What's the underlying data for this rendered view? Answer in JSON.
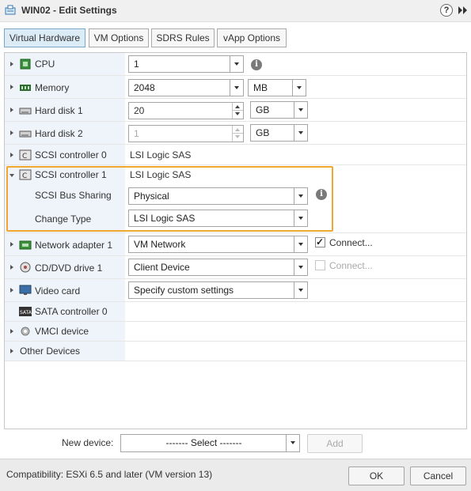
{
  "window": {
    "title": "WIN02 - Edit Settings",
    "help": "?"
  },
  "tabs": [
    {
      "label": "Virtual Hardware"
    },
    {
      "label": "VM Options"
    },
    {
      "label": "SDRS Rules"
    },
    {
      "label": "vApp Options"
    }
  ],
  "hardware": {
    "cpu": {
      "label": "CPU",
      "value": "1"
    },
    "memory": {
      "label": "Memory",
      "value": "2048",
      "unit": "MB"
    },
    "hard_disk_1": {
      "label": "Hard disk 1",
      "value": "20",
      "unit": "GB"
    },
    "hard_disk_2": {
      "label": "Hard disk 2",
      "value": "1",
      "unit": "GB"
    },
    "scsi_controller_0": {
      "label": "SCSI controller 0",
      "value": "LSI Logic SAS"
    },
    "scsi_controller_1": {
      "label": "SCSI controller 1",
      "value": "LSI Logic SAS",
      "bus_sharing": {
        "label": "SCSI Bus Sharing",
        "value": "Physical"
      },
      "change_type": {
        "label": "Change Type",
        "value": "LSI Logic SAS"
      }
    },
    "network_adapter_1": {
      "label": "Network adapter 1",
      "value": "VM Network",
      "connect_label": "Connect...",
      "connected": true
    },
    "cd_dvd_drive_1": {
      "label": "CD/DVD drive 1",
      "value": "Client Device",
      "connect_label": "Connect...",
      "connected": false
    },
    "video_card": {
      "label": "Video card",
      "value": "Specify custom settings"
    },
    "sata_controller_0": {
      "label": "SATA controller 0"
    },
    "vmci_device": {
      "label": "VMCI device"
    },
    "other_devices": {
      "label": "Other Devices"
    }
  },
  "new_device": {
    "label": "New device:",
    "select_value": "------- Select -------",
    "add_label": "Add"
  },
  "footer": {
    "compatibility": "Compatibility: ESXi 6.5 and later (VM version 13)",
    "ok_label": "OK",
    "cancel_label": "Cancel"
  },
  "colors": {
    "highlight": "#f0a830",
    "active_tab": "#dcecf7",
    "label_column": "#eef4fa",
    "footer": "#ebebeb"
  },
  "icons": [
    "vm-icon",
    "forward-icon",
    "cpu-icon",
    "memory-icon",
    "hard-disk-icon",
    "scsi-controller-icon",
    "network-adapter-icon",
    "cd-dvd-icon",
    "video-card-icon",
    "sata-controller-icon",
    "vmci-device-icon",
    "info-icon"
  ]
}
